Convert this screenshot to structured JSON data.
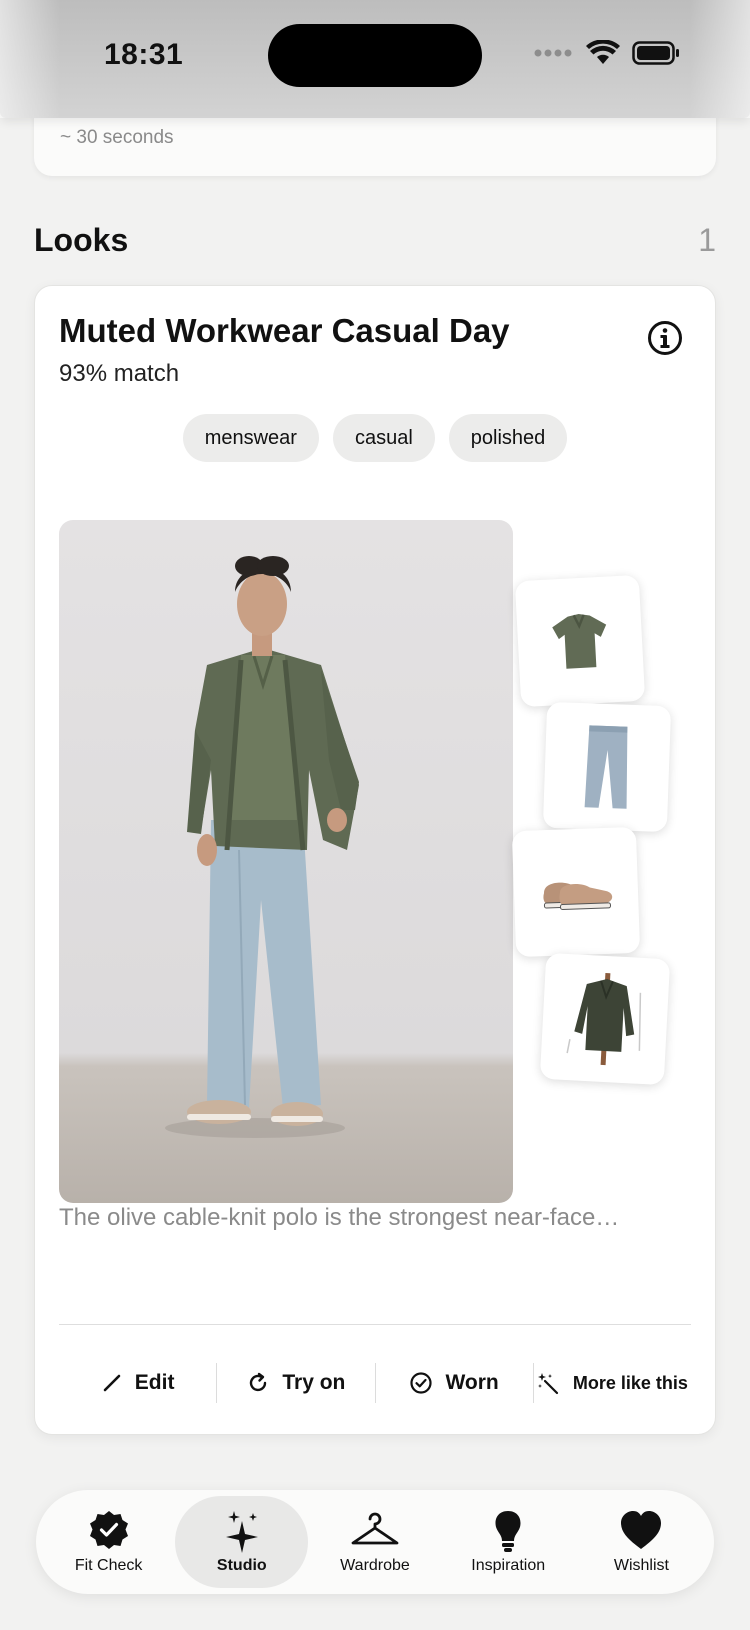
{
  "status_bar": {
    "time": "18:31"
  },
  "previous_card": {
    "duration": "~ 30 seconds"
  },
  "looks": {
    "title": "Looks",
    "count": "1",
    "card": {
      "title": "Muted Workwear Casual Day",
      "match": "93% match",
      "tags": [
        "menswear",
        "casual",
        "polished"
      ],
      "items": [
        {
          "name": "olive polo shirt",
          "icon": "polo-icon"
        },
        {
          "name": "light blue jeans",
          "icon": "jeans-icon"
        },
        {
          "name": "tan loafers",
          "icon": "loafers-icon"
        },
        {
          "name": "olive overshirt jacket",
          "icon": "jacket-icon"
        }
      ],
      "description": "The olive cable-knit polo is the strongest near-face…",
      "actions": {
        "edit": "Edit",
        "try_on": "Try on",
        "worn": "Worn",
        "more_like_this": "More like this"
      }
    }
  },
  "tab_bar": {
    "tabs": [
      {
        "label": "Fit Check",
        "icon": "verified-badge-icon",
        "active": false
      },
      {
        "label": "Studio",
        "icon": "sparkles-icon",
        "active": true
      },
      {
        "label": "Wardrobe",
        "icon": "hanger-icon",
        "active": false
      },
      {
        "label": "Inspiration",
        "icon": "lightbulb-icon",
        "active": false
      },
      {
        "label": "Wishlist",
        "icon": "heart-icon",
        "active": false
      }
    ]
  },
  "colors": {
    "background": "#f2f2f1",
    "card": "#ffffff",
    "accent_text": "#111111",
    "muted_text": "#8a8a8a",
    "chip": "#ececeb"
  }
}
